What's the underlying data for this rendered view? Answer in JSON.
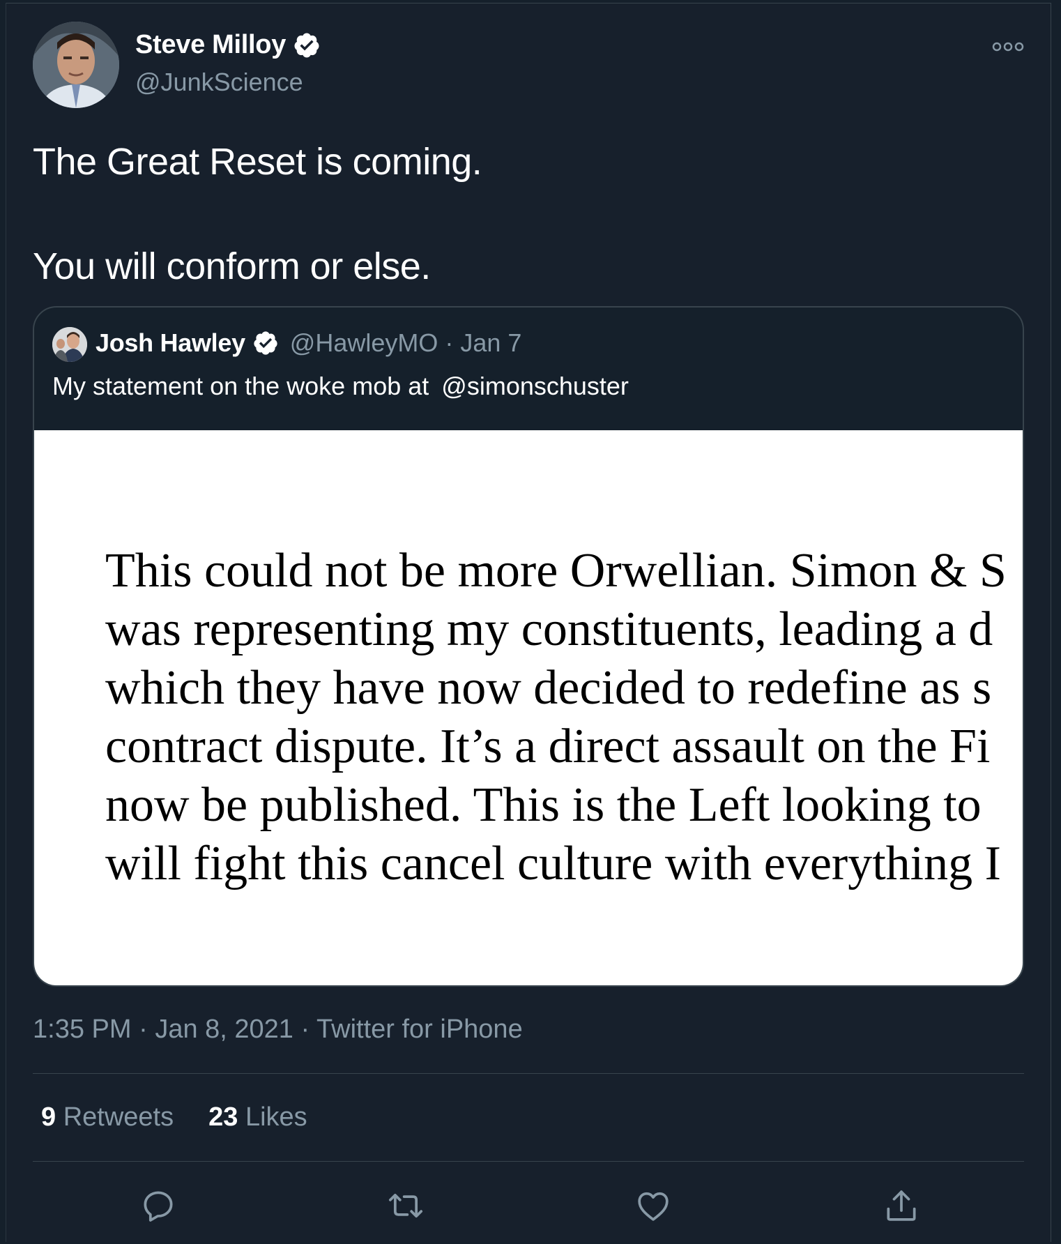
{
  "tweet": {
    "author_name": "Steve Milloy",
    "author_handle": "@JunkScience",
    "text_line1": "The Great Reset is coming.",
    "text_line2": "You will conform or else.",
    "time": "1:35 PM",
    "date": "Jan 8, 2021",
    "source": "Twitter for iPhone",
    "separator": "·"
  },
  "quoted": {
    "author_name": "Josh Hawley",
    "author_handle": "@HawleyMO",
    "date": "Jan 7",
    "text_prefix": "My statement on the woke mob at",
    "mention": "@simonschuster",
    "statement_lines": [
      "This could not be more Orwellian. Simon & S",
      "was representing my constituents, leading a d",
      "which they have now decided to redefine as s",
      "contract dispute. It’s a direct assault on the Fi",
      "now be published. This is the Left looking to ",
      "will fight this cancel culture with everything I"
    ]
  },
  "stats": {
    "retweets_count": "9",
    "retweets_label": "Retweets",
    "likes_count": "23",
    "likes_label": "Likes"
  },
  "colors": {
    "background": "#15202b",
    "secondary_text": "#8899a6",
    "border": "#38444d"
  },
  "icons": [
    "verified-icon",
    "more-icon",
    "reply-icon",
    "retweet-icon",
    "like-icon",
    "share-icon"
  ]
}
